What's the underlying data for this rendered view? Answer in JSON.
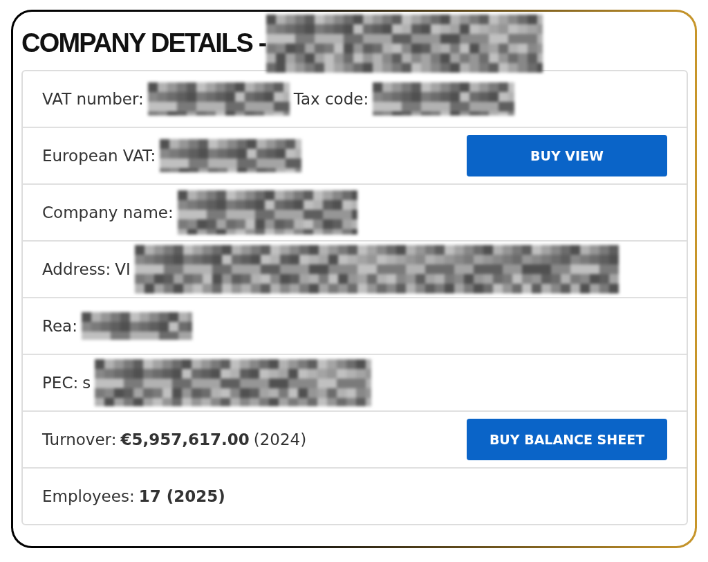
{
  "title": {
    "text": "COMPANY DETAILS -",
    "redacted": true
  },
  "rows": [
    {
      "fields": [
        {
          "label": "VAT number:",
          "redacted": true
        },
        {
          "label": "Tax code:",
          "redacted": true
        }
      ]
    },
    {
      "fields": [
        {
          "label": "European VAT:",
          "redacted": true
        }
      ],
      "button": "BUY VIEW"
    },
    {
      "fields": [
        {
          "label": "Company name:",
          "redacted": true
        }
      ]
    },
    {
      "fields": [
        {
          "label": "Address:",
          "prefix": "VI",
          "redacted": true
        }
      ]
    },
    {
      "fields": [
        {
          "label": "Rea:",
          "redacted": true
        }
      ]
    },
    {
      "fields": [
        {
          "label": "PEC:",
          "prefix": "s",
          "redacted": true
        }
      ]
    },
    {
      "fields": [
        {
          "label": "Turnover:",
          "value": "€5,957,617.00",
          "note": "(2024)"
        }
      ],
      "button": "BUY BALANCE SHEET"
    },
    {
      "fields": [
        {
          "label": "Employees:",
          "value": "17 (2025)"
        }
      ]
    }
  ]
}
